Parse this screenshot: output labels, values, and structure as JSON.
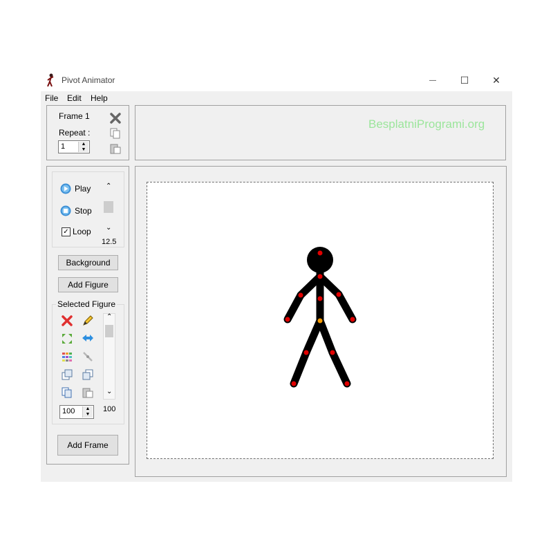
{
  "window": {
    "title": "Pivot Animator",
    "controls": {
      "minimize": "—",
      "maximize": "☐",
      "close": "✕"
    }
  },
  "menu": [
    "File",
    "Edit",
    "Help"
  ],
  "frame_panel": {
    "frame_label": "Frame 1",
    "repeat_label": "Repeat :",
    "repeat_value": "1"
  },
  "playback": {
    "play_label": "Play",
    "stop_label": "Stop",
    "loop_label": "Loop",
    "loop_checked": true,
    "speed_value": "12.5"
  },
  "buttons": {
    "background": "Background",
    "add_figure": "Add Figure",
    "add_frame": "Add Frame"
  },
  "selected_figure": {
    "heading": "Selected Figure",
    "size_value": "100",
    "scale_label": "100"
  },
  "watermark": "BesplatniProgrami.org",
  "colors": {
    "figure": "#000000",
    "joint_handle": "#e00000",
    "center_handle": "#f59a00",
    "window_bg": "#f0f0f0"
  }
}
